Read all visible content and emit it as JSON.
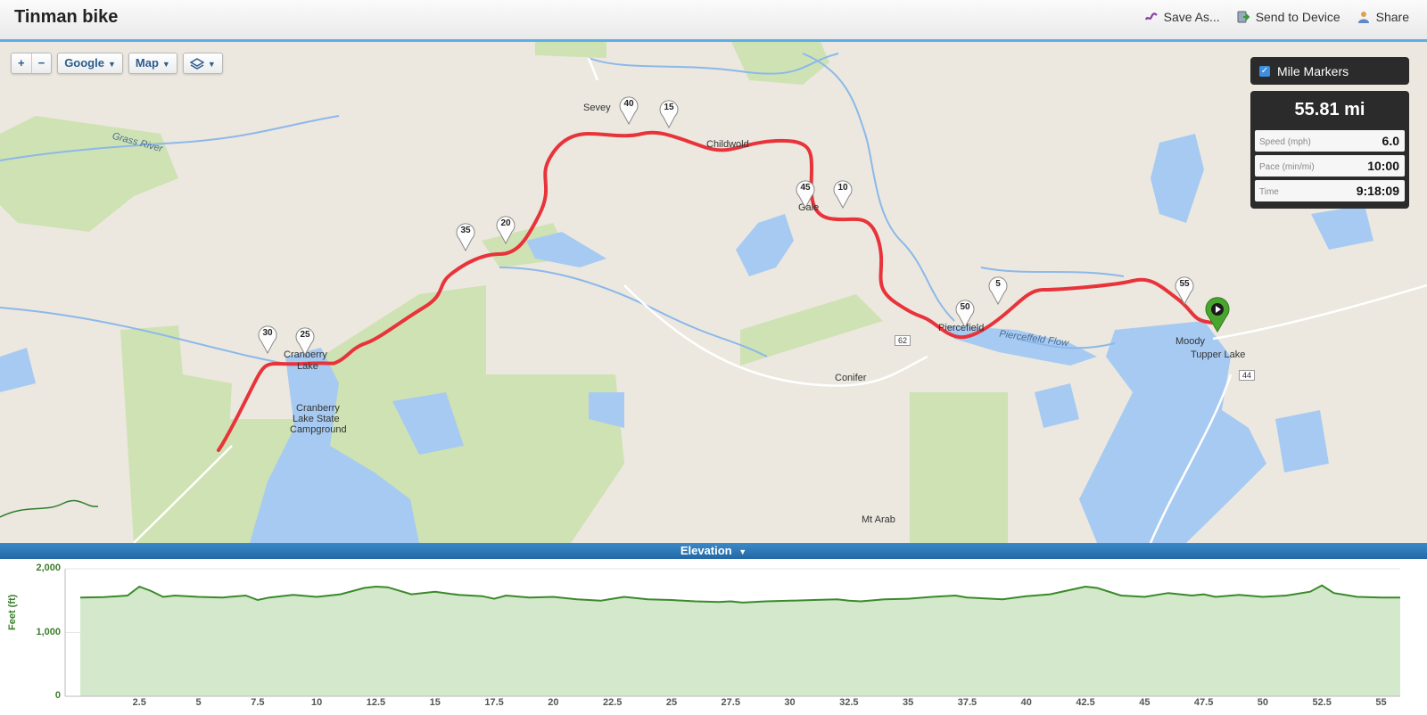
{
  "header": {
    "title": "Tinman bike",
    "actions": [
      {
        "label": "Save As...",
        "icon": "save-as-icon"
      },
      {
        "label": "Send to Device",
        "icon": "send-to-device-icon"
      },
      {
        "label": "Share",
        "icon": "share-icon"
      }
    ]
  },
  "map": {
    "zoom_in": "+",
    "zoom_out": "−",
    "provider": "Google",
    "map_type": "Map",
    "layers_icon": "layers-icon",
    "mile_markers_label": "Mile Markers",
    "mile_markers_checked": true,
    "markers": [
      "5",
      "10",
      "15",
      "20",
      "25",
      "30",
      "35",
      "40",
      "45",
      "50",
      "55"
    ],
    "labels": [
      "Sevey",
      "Childwold",
      "Gale",
      "Piercefield",
      "Pierceffeld Flow",
      "Moody",
      "Tupper Lake",
      "Cranberry",
      "Lake",
      "Cranberry",
      "Lake State",
      "Campground",
      "Conifer",
      "Mt Arab",
      "Grass River",
      "62",
      "44"
    ],
    "route_color": "#e8333b",
    "start_marker_color": "#4aa52e"
  },
  "stats": {
    "distance": "55.81 mi",
    "speed_label": "Speed (mph)",
    "speed": "6.0",
    "pace_label": "Pace (min/mi)",
    "pace": "10:00",
    "time_label": "Time",
    "time": "9:18:09"
  },
  "elevation": {
    "bar_label": "Elevation",
    "ylabel": "Feet (ft)",
    "yticks": [
      "2,000",
      "1,000",
      "0"
    ],
    "xticks": [
      "2.5",
      "5",
      "7.5",
      "10",
      "12.5",
      "15",
      "17.5",
      "20",
      "22.5",
      "25",
      "27.5",
      "30",
      "32.5",
      "35",
      "37.5",
      "40",
      "42.5",
      "45",
      "47.5",
      "50",
      "52.5",
      "55"
    ],
    "line_color": "#3a8a2a",
    "fill_color": "#d4e8cc"
  },
  "chart_data": {
    "type": "area",
    "title": "Elevation",
    "xlabel": "",
    "ylabel": "Feet (ft)",
    "xlim": [
      0,
      55.81
    ],
    "ylim": [
      0,
      2000
    ],
    "x": [
      0,
      1,
      2,
      2.5,
      3,
      3.5,
      4,
      5,
      6,
      7,
      7.5,
      8,
      9,
      10,
      11,
      12,
      12.5,
      13,
      14,
      15,
      16,
      17,
      17.5,
      18,
      19,
      20,
      21,
      22,
      22.5,
      23,
      24,
      25,
      26,
      27,
      27.5,
      28,
      29,
      30,
      31,
      32,
      32.5,
      33,
      34,
      35,
      36,
      37,
      37.5,
      38,
      39,
      40,
      41,
      42,
      42.5,
      43,
      44,
      45,
      46,
      47,
      47.5,
      48,
      49,
      50,
      51,
      52,
      52.5,
      53,
      54,
      55,
      55.81
    ],
    "series": [
      {
        "values": [
          1550,
          1555,
          1580,
          1720,
          1650,
          1560,
          1580,
          1560,
          1550,
          1580,
          1510,
          1550,
          1590,
          1560,
          1600,
          1700,
          1720,
          1710,
          1600,
          1640,
          1590,
          1570,
          1530,
          1580,
          1550,
          1560,
          1520,
          1500,
          1530,
          1560,
          1520,
          1510,
          1490,
          1480,
          1490,
          1470,
          1490,
          1500,
          1510,
          1520,
          1500,
          1490,
          1520,
          1530,
          1560,
          1580,
          1550,
          1540,
          1520,
          1570,
          1600,
          1680,
          1720,
          1700,
          1580,
          1560,
          1620,
          1580,
          1600,
          1560,
          1590,
          1560,
          1580,
          1640,
          1740,
          1620,
          1560,
          1550,
          1550
        ]
      }
    ]
  }
}
